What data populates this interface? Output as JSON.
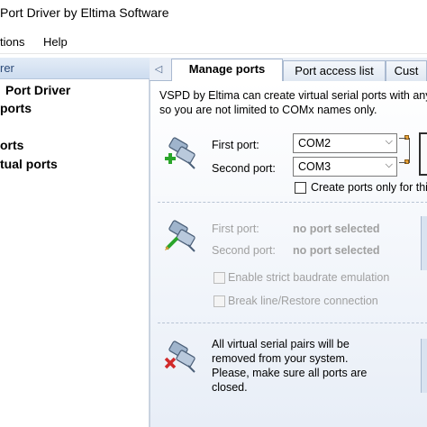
{
  "window": {
    "title": "Port Driver by Eltima Software"
  },
  "menu": {
    "items": [
      "tions",
      "Help"
    ]
  },
  "left_pane": {
    "header": "rer",
    "tree": [
      "Port Driver",
      "ports",
      "orts",
      "tual ports"
    ]
  },
  "tabs": [
    {
      "label": "Manage ports",
      "active": true
    },
    {
      "label": "Port access list",
      "active": false
    },
    {
      "label": "Cust",
      "active": false
    }
  ],
  "manage": {
    "description_line1": "VSPD by Eltima can create virtual serial ports with any",
    "description_line2": "so you are not limited to COMx names only.",
    "add_pair": {
      "first_port_label": "First port:",
      "first_port_value": "COM2",
      "second_port_label": "Second port:",
      "second_port_value": "COM3",
      "create_only_label": "Create ports only for thi",
      "create_only_checked": false
    },
    "edit_pair": {
      "first_port_label": "First port:",
      "first_port_value": "no port selected",
      "second_port_label": "Second port:",
      "second_port_value": "no port selected",
      "strict_baud_label": "Enable strict baudrate emulation",
      "break_line_label": "Break line/Restore connection"
    },
    "delete_all": {
      "message_line1": "All virtual serial pairs will be",
      "message_line2": "removed from your system.",
      "message_line3": "Please, make sure all ports are",
      "message_line4": "closed."
    }
  },
  "colors": {
    "accent_tab_bg": "#ffffff",
    "pane_header": "#cddcef",
    "disabled_text": "#a0a0a0",
    "add_icon": "#2aa52a",
    "delete_icon": "#d12a2a"
  },
  "icons": {
    "tab_scroll": "chevron-left-icon",
    "add_pair": "port-add-icon",
    "edit_pair": "port-edit-icon",
    "delete_pair": "port-delete-icon"
  }
}
